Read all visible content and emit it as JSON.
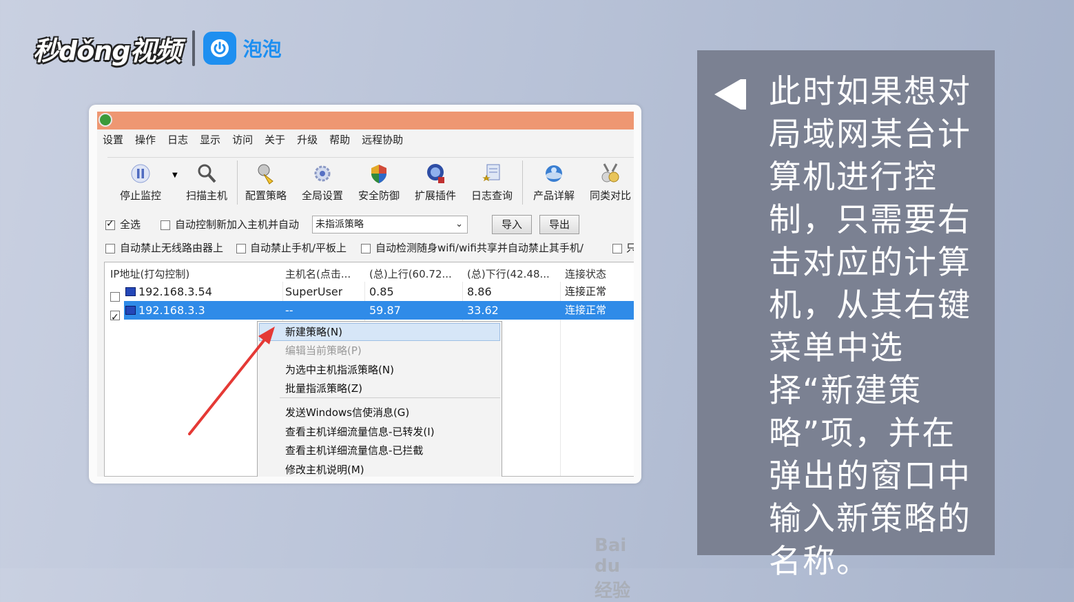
{
  "brand": {
    "logo_text": "秒dǒng视频",
    "partner_name": "泡泡",
    "partner_icon": "power-icon"
  },
  "window": {
    "menu": [
      "设置",
      "操作",
      "日志",
      "显示",
      "访问",
      "关于",
      "升级",
      "帮助",
      "远程协助"
    ],
    "toolbar": [
      {
        "label": "停止监控",
        "icon": "pause-icon"
      },
      {
        "label": "扫描主机",
        "icon": "magnifier-icon"
      },
      {
        "label": "配置策略",
        "icon": "config-icon"
      },
      {
        "label": "全局设置",
        "icon": "gear-icon"
      },
      {
        "label": "安全防御",
        "icon": "shield-icon"
      },
      {
        "label": "扩展插件",
        "icon": "plugin-icon"
      },
      {
        "label": "日志查询",
        "icon": "log-icon"
      },
      {
        "label": "产品详解",
        "icon": "globe-icon"
      },
      {
        "label": "同类对比",
        "icon": "medal-icon"
      }
    ],
    "options": {
      "select_all": "全选",
      "auto_control": "自动控制新加入主机并自动",
      "policy_select": "未指派策略",
      "import": "导入",
      "export": "导出",
      "row2": [
        "自动禁止无线路由器上",
        "自动禁止手机/平板上",
        "自动检测随身wifi/wifi共享并自动禁止其手机/",
        "只"
      ]
    },
    "table": {
      "headers": [
        "IP地址(打勾控制)",
        "主机名(点击...",
        "(总)上行(60.72...",
        "(总)下行(42.48...",
        "连接状态"
      ],
      "rows": [
        {
          "ip": "192.168.3.54",
          "host": "SuperUser",
          "up": "0.85",
          "down": "8.86",
          "status": "连接正常",
          "checked": false,
          "selected": false
        },
        {
          "ip": "192.168.3.3",
          "host": "--",
          "up": "59.87",
          "down": "33.62",
          "status": "连接正常",
          "checked": true,
          "selected": true
        }
      ]
    },
    "context_menu": {
      "group1": [
        "新建策略(N)",
        "编辑当前策略(P)",
        "为选中主机指派策略(N)",
        "批量指派策略(Z)"
      ],
      "group2": [
        "发送Windows信使消息(G)",
        "查看主机详细流量信息-已转发(I)",
        "查看主机详细流量信息-已拦截",
        "修改主机说明(M)"
      ]
    },
    "watermark": "Bai du 经验"
  },
  "caption": {
    "text": "此时如果想对局域网某台计算机进行控制，只需要右击对应的计算机，从其右键菜单中选择“新建策略”项，并在弹出的窗口中输入新策略的名称。"
  },
  "colors": {
    "titlebar": "#ee9772",
    "selection": "#2f8be8",
    "caption_bg": "#7b8192",
    "arrow": "#e53935"
  }
}
